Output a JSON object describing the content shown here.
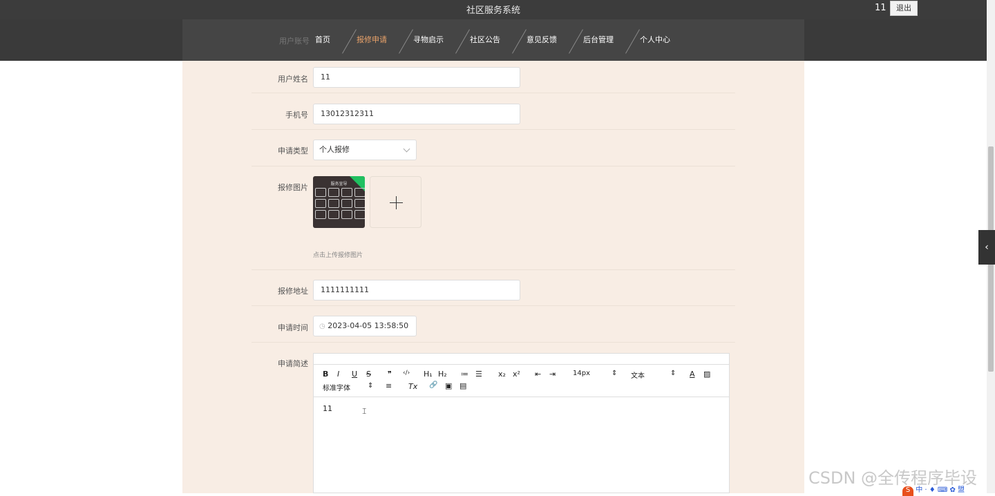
{
  "app": {
    "title": "社区服务系统",
    "user": "11",
    "logout_label": "退出"
  },
  "nav": {
    "behind_label": "用户账号",
    "items": [
      {
        "label": "首页",
        "active": false
      },
      {
        "label": "报修申请",
        "active": true
      },
      {
        "label": "寻物启示",
        "active": false
      },
      {
        "label": "社区公告",
        "active": false
      },
      {
        "label": "意见反馈",
        "active": false
      },
      {
        "label": "后台管理",
        "active": false
      },
      {
        "label": "个人中心",
        "active": false
      }
    ]
  },
  "form": {
    "name": {
      "label": "用户姓名",
      "value": "11"
    },
    "phone": {
      "label": "手机号",
      "value": "13012312311"
    },
    "type": {
      "label": "申请类型",
      "value": "个人报修"
    },
    "image": {
      "label": "报修图片",
      "thumb_title": "服务宣导",
      "hint": "点击上传报修图片"
    },
    "address": {
      "label": "报修地址",
      "value": "1111111111"
    },
    "time": {
      "label": "申请时间",
      "value": "2023-04-05 13:58:50"
    },
    "desc": {
      "label": "申请简述",
      "content": "11"
    }
  },
  "editor": {
    "toolbar": {
      "bold": "B",
      "italic": "I",
      "underline": "U",
      "strike": "S",
      "quote": "❞",
      "code": "‹/›",
      "h1": "H₁",
      "h2": "H₂",
      "ol": "≔",
      "ul": "☰",
      "sub": "x₂",
      "sup": "x²",
      "outdent": "⇤",
      "indent": "⇥",
      "size": "14px",
      "size_arrow": "⇕",
      "header": "文本",
      "header_arrow": "⇕",
      "color": "A",
      "bg": "▨",
      "font": "标准字体",
      "font_arrow": "⇕",
      "align": "≡",
      "clean": "Tx",
      "link": "🔗",
      "image": "▣",
      "video": "▤"
    }
  },
  "overlay": {
    "watermark": "CSDN @全传程序毕设",
    "ime": "中 · ♦ ⌨ ✿ 盟",
    "ime_logo": "S"
  },
  "colors": {
    "topbar": "#3c3c3c",
    "accent": "#e9a26a",
    "page_bg": "#f8ede4"
  }
}
